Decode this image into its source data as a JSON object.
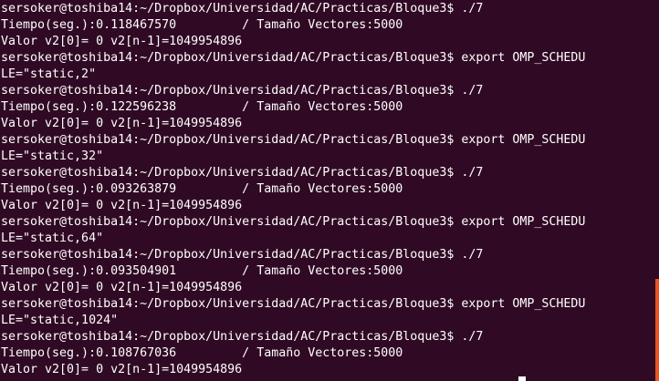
{
  "terminal": {
    "accent_color": "#e95420",
    "background_color": "#300a24",
    "text_color": "#ffffff",
    "lines": [
      "sersoker@toshiba14:~/Dropbox/Universidad/AC/Practicas/Bloque3$ ./7",
      "Tiempo(seg.):0.118467570         / Tamaño Vectores:5000",
      "Valor v2[0]= 0 v2[n-1]=1049954896",
      "sersoker@toshiba14:~/Dropbox/Universidad/AC/Practicas/Bloque3$ export OMP_SCHEDU",
      "LE=\"static,2\"",
      "sersoker@toshiba14:~/Dropbox/Universidad/AC/Practicas/Bloque3$ ./7",
      "Tiempo(seg.):0.122596238         / Tamaño Vectores:5000",
      "Valor v2[0]= 0 v2[n-1]=1049954896",
      "sersoker@toshiba14:~/Dropbox/Universidad/AC/Practicas/Bloque3$ export OMP_SCHEDU",
      "LE=\"static,32\"",
      "sersoker@toshiba14:~/Dropbox/Universidad/AC/Practicas/Bloque3$ ./7",
      "Tiempo(seg.):0.093263879         / Tamaño Vectores:5000",
      "Valor v2[0]= 0 v2[n-1]=1049954896",
      "sersoker@toshiba14:~/Dropbox/Universidad/AC/Practicas/Bloque3$ export OMP_SCHEDU",
      "LE=\"static,64\"",
      "sersoker@toshiba14:~/Dropbox/Universidad/AC/Practicas/Bloque3$ ./7",
      "Tiempo(seg.):0.093504901         / Tamaño Vectores:5000",
      "Valor v2[0]= 0 v2[n-1]=1049954896",
      "sersoker@toshiba14:~/Dropbox/Universidad/AC/Practicas/Bloque3$ export OMP_SCHEDU",
      "LE=\"static,1024\"",
      "sersoker@toshiba14:~/Dropbox/Universidad/AC/Practicas/Bloque3$ ./7",
      "Tiempo(seg.):0.108767036         / Tamaño Vectores:5000",
      "Valor v2[0]= 0 v2[n-1]=1049954896"
    ]
  }
}
